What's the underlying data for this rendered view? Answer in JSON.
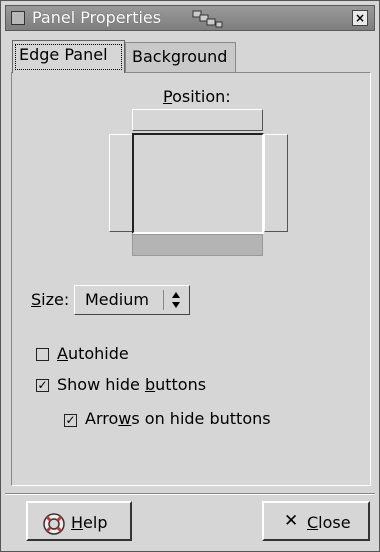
{
  "window": {
    "title": "Panel Properties",
    "close_glyph": "×"
  },
  "tabs": [
    {
      "label": "Edge Panel",
      "active": true
    },
    {
      "label": "Background",
      "active": false
    }
  ],
  "position": {
    "label_mnemonic": "P",
    "label_rest": "osition:",
    "selected_edge": "bottom"
  },
  "size": {
    "label_mnemonic": "S",
    "label_rest": "ize:",
    "value": "Medium"
  },
  "checkboxes": {
    "autohide": {
      "pre": "",
      "mnemonic": "A",
      "post": "utohide",
      "checked": false
    },
    "show_hide_buttons": {
      "pre": "Show hide ",
      "mnemonic": "b",
      "post": "uttons",
      "checked": true
    },
    "arrows_on_hide_buttons": {
      "pre": "Arro",
      "mnemonic": "w",
      "post": "s on hide buttons",
      "checked": true
    }
  },
  "buttons": {
    "help": {
      "mnemonic": "H",
      "rest": "elp",
      "icon": "help-lifebuoy-icon"
    },
    "close": {
      "mnemonic": "C",
      "rest": "lose",
      "icon": "close-x-icon"
    }
  },
  "checkmark": "✓",
  "x_glyph": "✕"
}
